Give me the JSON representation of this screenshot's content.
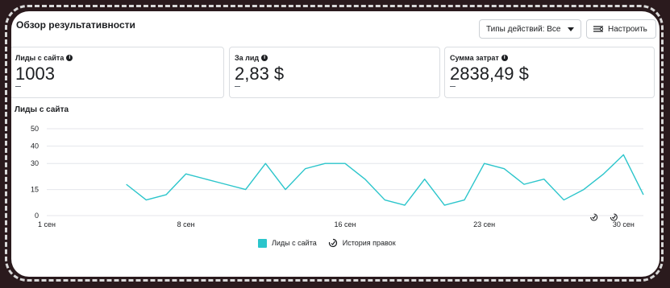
{
  "header": {
    "title": "Обзор результативности",
    "action_types_label": "Типы действий: Все",
    "configure_label": "Настроить"
  },
  "metrics": [
    {
      "label": "Лиды с сайта",
      "value": "1003",
      "sub": ""
    },
    {
      "label": "За лид",
      "value": "2,83 $",
      "sub": ""
    },
    {
      "label": "Сумма затрат",
      "value": "2838,49 $",
      "sub": ""
    }
  ],
  "chart_title": "Лиды с сайта",
  "legend": {
    "series_label": "Лиды с сайта",
    "history_label": "История правок"
  },
  "colors": {
    "series": "#2bc5cb",
    "grid": "#e4e6eb",
    "text": "#1c1e21"
  },
  "chart_data": {
    "type": "line",
    "x": [
      1,
      2,
      3,
      4,
      5,
      6,
      7,
      8,
      9,
      10,
      11,
      12,
      13,
      14,
      15,
      16,
      17,
      18,
      19,
      20,
      21,
      22,
      23,
      24,
      25,
      26,
      27,
      28,
      29,
      30
    ],
    "series": [
      {
        "name": "Лиды с сайта",
        "values": [
          null,
          null,
          null,
          null,
          18,
          9,
          12,
          24,
          21,
          18,
          15,
          30,
          15,
          27,
          30,
          30,
          21,
          9,
          6,
          21,
          6,
          9,
          30,
          27,
          18,
          21,
          9,
          15,
          24,
          35,
          12
        ]
      }
    ],
    "x_ticks": [
      {
        "x": 1,
        "label": "1 сен"
      },
      {
        "x": 8,
        "label": "8 сен"
      },
      {
        "x": 16,
        "label": "16 сен"
      },
      {
        "x": 23,
        "label": "23 сен"
      },
      {
        "x": 30,
        "label": "30 сен"
      }
    ],
    "y_ticks": [
      0,
      15,
      30,
      40,
      50
    ],
    "ylim": [
      0,
      50
    ],
    "xlim": [
      1,
      31
    ],
    "grid": true,
    "legend_placement": "bottom",
    "history_markers_x": [
      29,
      30
    ]
  }
}
